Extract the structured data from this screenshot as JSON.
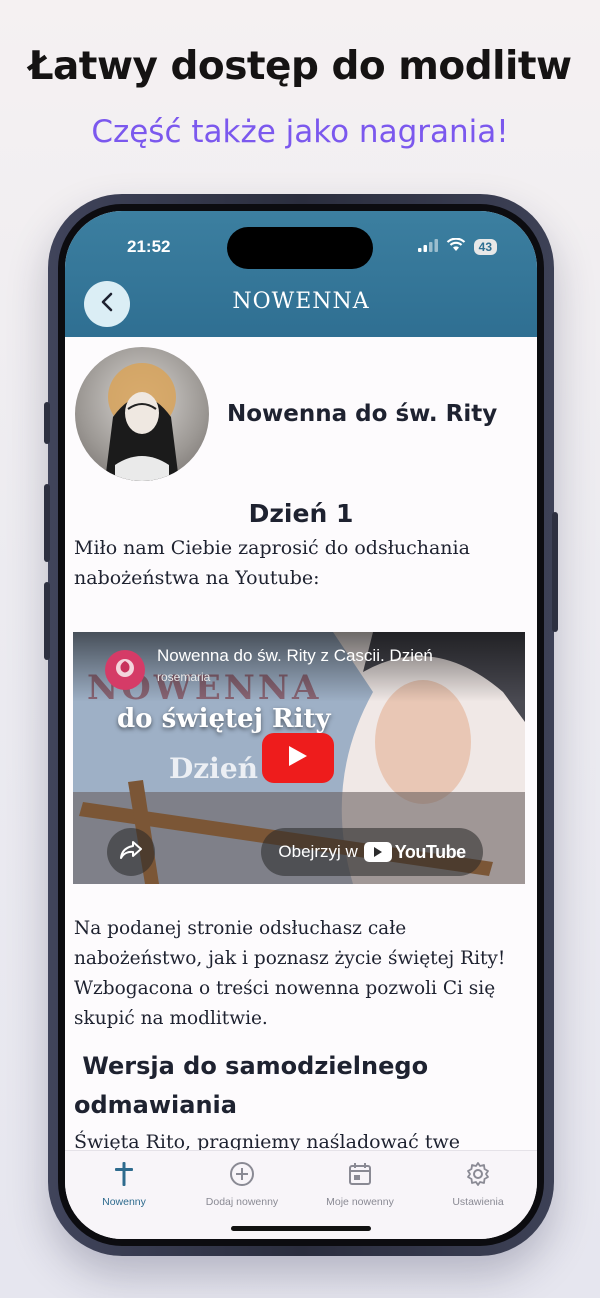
{
  "promo": {
    "headline": "Łatwy dostęp do modlitw",
    "subheadline": "Część także jako nagrania!"
  },
  "status_bar": {
    "time": "21:52",
    "battery": "43"
  },
  "app_bar": {
    "title": "NOWENNA"
  },
  "novena": {
    "title": "Nowenna do św. Rity",
    "day_title": "Dzień 1",
    "intro": "Miło nam Ciebie zaprosić do odsłuchania nabożeństwa na Youtube:",
    "after_video": "Na podanej stronie odsłuchasz całe nabożeństwo, jak i poznasz życie świętej Rity! Wzbogacona o treści nowenna pozwoli Ci się skupić na modlitwie.",
    "section_title": "Wersja do samodzielnego odmawiania",
    "prayer_start": "Święta Rito, pragniemy naśladować twe"
  },
  "video": {
    "title": "Nowenna do św. Rity z Cascii. Dzień",
    "channel": "rosemaria",
    "art_line1": "NOWENNA",
    "art_line2": "do świętej Rity",
    "art_line3": "Dzień",
    "watch_on": "Obejrzyj w",
    "youtube_brand": "YouTube"
  },
  "tabs": [
    {
      "label": "Nowenny",
      "icon": "cross-icon",
      "active": true
    },
    {
      "label": "Dodaj nowenny",
      "icon": "plus-circle-icon",
      "active": false
    },
    {
      "label": "Moje nowenny",
      "icon": "calendar-icon",
      "active": false
    },
    {
      "label": "Ustawienia",
      "icon": "gear-icon",
      "active": false
    }
  ],
  "colors": {
    "app_bar": "#2f6f92",
    "accent_purple": "#7b58ee",
    "active_tab": "#2e6b8e",
    "youtube_red": "#ee1c1c"
  }
}
